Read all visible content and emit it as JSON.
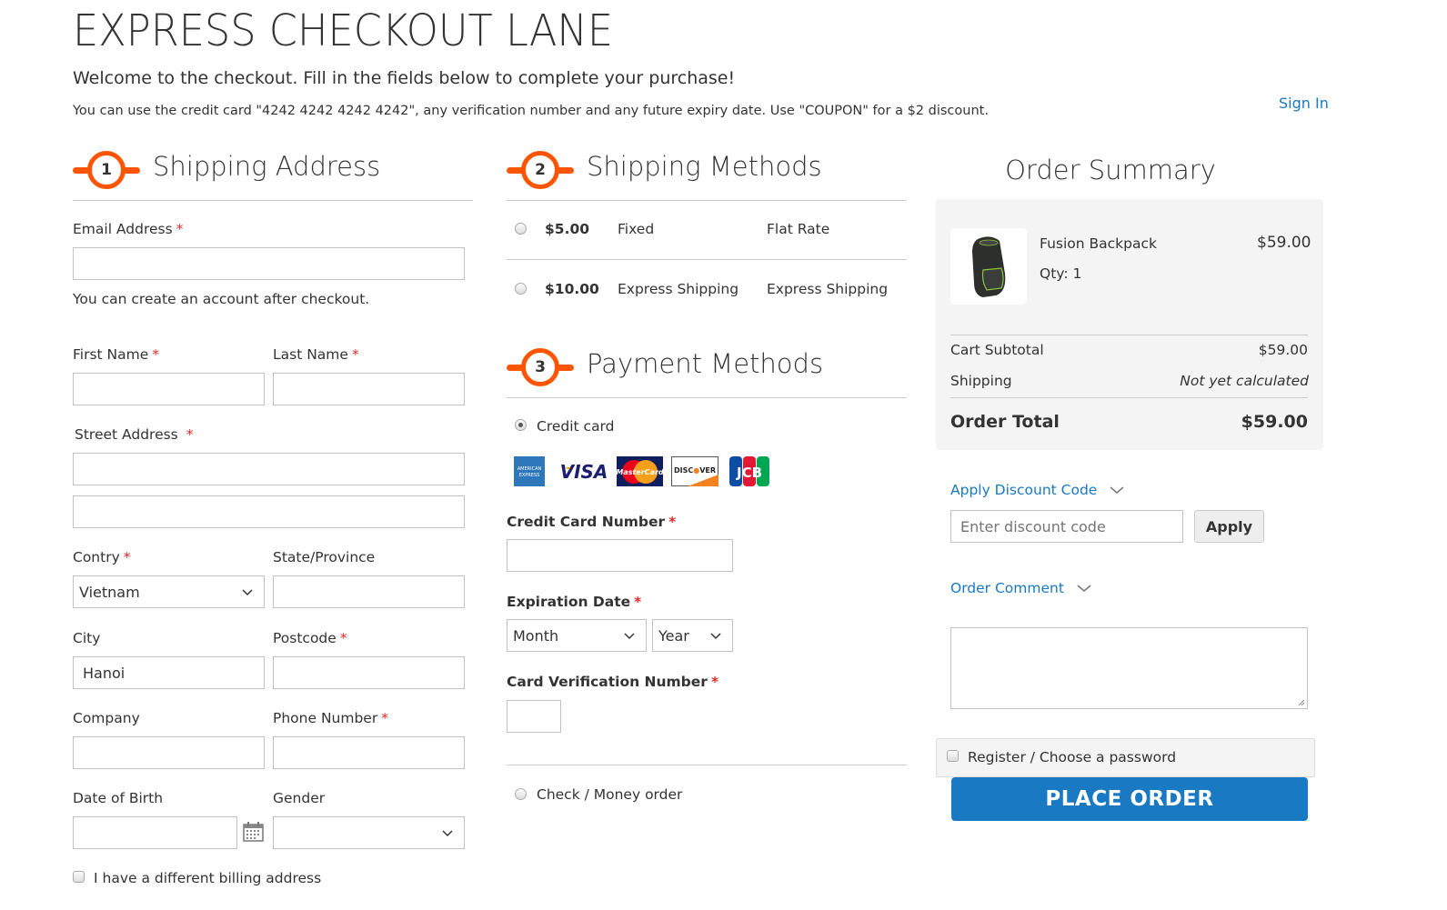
{
  "header": {
    "title": "EXPRESS CHECKOUT LANE",
    "welcome": "Welcome to the checkout. Fill in the fields below to complete your purchase!",
    "hint": "You can use the credit card \"4242 4242 4242 4242\", any verification number and any future expiry date. Use \"COUPON\" for a $2 discount.",
    "sign_in": "Sign In"
  },
  "shipping_address": {
    "step": "1",
    "title": "Shipping Address",
    "email_label": "Email Address",
    "email_value": "",
    "email_note": "You can create an account after checkout.",
    "first_name_label": "First Name",
    "last_name_label": "Last Name",
    "street_label": "Street Address",
    "country_label": "Contry",
    "country_value": "Vietnam",
    "state_label": "State/Province",
    "city_label": "City",
    "city_value": "Hanoi",
    "postcode_label": "Postcode",
    "company_label": "Company",
    "phone_label": "Phone Number",
    "dob_label": "Date of Birth",
    "gender_label": "Gender",
    "gender_value": "",
    "billing_checkbox_label": "I have a different billing address",
    "required_mark": "*"
  },
  "shipping_methods": {
    "step": "2",
    "title": "Shipping Methods",
    "options": [
      {
        "price": "$5.00",
        "method": "Fixed",
        "carrier": "Flat Rate",
        "selected": false
      },
      {
        "price": "$10.00",
        "method": "Express Shipping",
        "carrier": "Express Shipping",
        "selected": false
      }
    ]
  },
  "payment_methods": {
    "step": "3",
    "title": "Payment Methods",
    "credit_card_label": "Credit card",
    "credit_card_selected": true,
    "cards": [
      "American Express",
      "VISA",
      "MasterCard",
      "DISCOVER",
      "JCB"
    ],
    "cc_number_label": "Credit Card Number",
    "expiration_label": "Expiration Date",
    "month_value": "Month",
    "year_value": "Year",
    "cvv_label": "Card Verification Number",
    "check_money_order_label": "Check / Money order"
  },
  "order_summary": {
    "title": "Order Summary",
    "item": {
      "name": "Fusion Backpack",
      "qty": "Qty: 1",
      "price": "$59.00"
    },
    "subtotal_label": "Cart Subtotal",
    "subtotal_value": "$59.00",
    "shipping_label": "Shipping",
    "shipping_value": "Not yet calculated",
    "total_label": "Order Total",
    "total_value": "$59.00",
    "discount_toggle": "Apply Discount Code",
    "discount_placeholder": "Enter discount code",
    "apply_button": "Apply",
    "comment_toggle": "Order Comment",
    "register_label": "Register / Choose a password",
    "place_order": "PLACE ORDER"
  }
}
